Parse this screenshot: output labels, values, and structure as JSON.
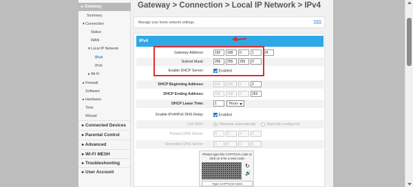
{
  "sidebar": {
    "top_label": "▸ Gateway",
    "items": [
      {
        "label": "Summary"
      },
      {
        "label": "▾ Connection"
      },
      {
        "label": "Status"
      },
      {
        "label": "WAN"
      },
      {
        "label": "▾ Local IP Network"
      },
      {
        "label": "IPv4"
      },
      {
        "label": "IPv6"
      },
      {
        "label": "▸ Wi-Fi"
      },
      {
        "label": "▸ Firewall"
      },
      {
        "label": "Software"
      },
      {
        "label": "▸ Hardware"
      },
      {
        "label": "Time"
      },
      {
        "label": "Wizard"
      },
      {
        "label": "▸ Connected Devices"
      },
      {
        "label": "▸ Parental Control"
      },
      {
        "label": "▸ Advanced"
      },
      {
        "label": "▸ Wi-Fi MESH"
      },
      {
        "label": "▸ Troubleshooting"
      },
      {
        "label": "▸ User Account"
      }
    ]
  },
  "header": {
    "title": "Gateway > Connection > Local IP Network > IPv4"
  },
  "description": {
    "text": "Manage your home network settings.",
    "help": "more"
  },
  "section": {
    "title": "IPv4"
  },
  "fields": {
    "gateway_address": {
      "label": "Gateway Address:",
      "octets": [
        "192",
        "168",
        "0",
        "1",
        "24"
      ]
    },
    "subnet_mask": {
      "label": "Subnet Mask:",
      "octets": [
        "255",
        "255",
        "255",
        "0"
      ]
    },
    "dhcp_server": {
      "label": "Enable DHCP Server:",
      "value": "Enabled"
    },
    "dhcp_begin": {
      "label": "DHCP Beginning Address:",
      "octets": [
        "192",
        "168",
        "0",
        "2"
      ]
    },
    "dhcp_end": {
      "label": "DHCP Ending Address:",
      "octets": [
        "192",
        "168",
        "0",
        "253"
      ]
    },
    "lease_time": {
      "label": "DHCP Lease Time:",
      "number": "1",
      "unit": "Hours"
    },
    "dns_relay": {
      "label": "Enable IPv4/IPv6 DNS Relay:",
      "value": "Enabled"
    },
    "link_dns": {
      "label": "Link DNS:",
      "option_auto": "Obtained automatically",
      "option_static": "Statically configured"
    },
    "primary_dns": {
      "label": "Primary DNS Server:",
      "octets": [
        "0",
        "0",
        "0",
        "0"
      ]
    },
    "secondary_dns": {
      "label": "Secondary DNS Server:",
      "octets": [
        "0",
        "0",
        "0",
        "0"
      ]
    }
  },
  "captcha": {
    "prompt": "Please type this CAPTCHA code or click on it for a new code:",
    "refresh_icon": "refresh-icon",
    "audio_icon": "speaker-icon",
    "input_placeholder": "Type CAPTCHA Here"
  },
  "colors": {
    "accent": "#2fa8e6",
    "highlight": "#e02a2a",
    "checkbox": "#2b6fd6"
  }
}
